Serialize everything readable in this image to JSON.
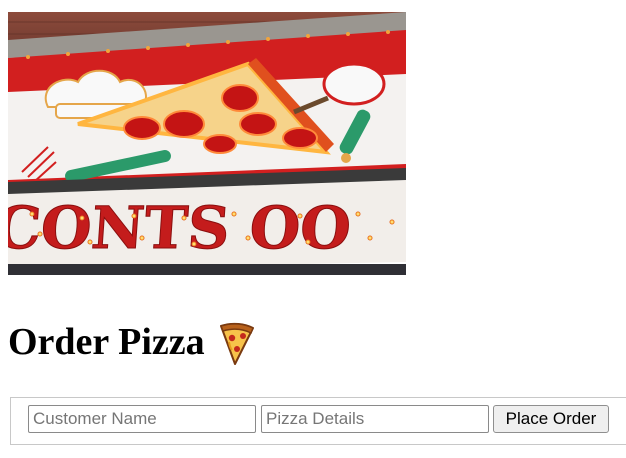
{
  "hero": {
    "sign_text": "CONTS OO"
  },
  "page": {
    "title": "Order Pizza"
  },
  "form": {
    "customer_name": {
      "placeholder": "Customer Name",
      "value": ""
    },
    "pizza_details": {
      "placeholder": "Pizza Details",
      "value": ""
    },
    "submit_label": "Place Order"
  },
  "icons": {
    "title_emoji": "pizza-slice-icon"
  },
  "colors": {
    "sign_red": "#d21f1f",
    "neon_orange": "#ffb640",
    "text": "#000000"
  }
}
